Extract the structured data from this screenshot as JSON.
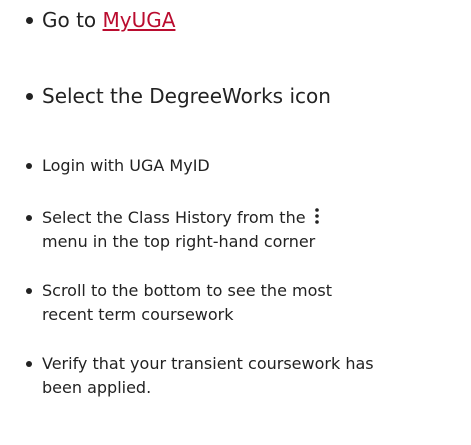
{
  "steps": [
    {
      "prefix": "Go to ",
      "link_text": "MyUGA"
    },
    {
      "text": "Select the DegreeWorks icon"
    },
    {
      "text": "Login with UGA MyID"
    },
    {
      "text_before_icon": "Select the Class History from the",
      "icon": "vertical-ellipsis-menu-icon",
      "text_after_icon": "menu in the top right-hand corner"
    },
    {
      "text": "Scroll to the bottom to see the most recent term coursework"
    },
    {
      "text": "Verify that your transient coursework has been applied."
    }
  ],
  "colors": {
    "link": "#ba0c2f",
    "text": "#222222"
  }
}
